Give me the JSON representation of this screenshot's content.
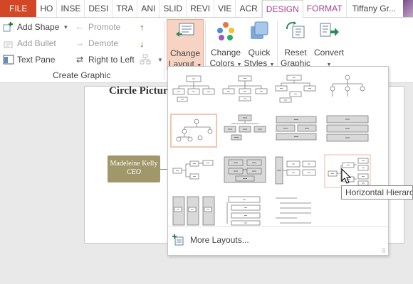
{
  "tabs": [
    "FILE",
    "HO",
    "INSE",
    "DESI",
    "TRA",
    "ANI",
    "SLID",
    "REVI",
    "VIE",
    "ACR",
    "DESIGN",
    "FORMAT"
  ],
  "user": "Tiffany Gr...",
  "ribbon": {
    "create_graphic": {
      "add_shape": "Add Shape",
      "add_bullet": "Add Bullet",
      "text_pane": "Text Pane",
      "promote": "Promote",
      "demote": "Demote",
      "right_to_left": "Right to Left",
      "group_label": "Create Graphic"
    },
    "change_layout": [
      "Change",
      "Layout"
    ],
    "change_colors": [
      "Change",
      "Colors"
    ],
    "quick_styles": [
      "Quick",
      "Styles"
    ],
    "reset_graphic": [
      "Reset",
      "Graphic"
    ],
    "convert": [
      "Convert",
      ""
    ]
  },
  "slide": {
    "title": "Circle Picture",
    "node_name": "Madeleine Kelly",
    "node_role": "CEO"
  },
  "gallery": {
    "more_layouts": "More Layouts...",
    "tooltip": "Horizontal Hierarchy",
    "selected_index": 4,
    "hover_index": 11
  },
  "colors": {
    "file_tab": "#d24726",
    "accent_tab": "#a94090",
    "active_button": "#f7d3c3",
    "node_fill": "#a0986a"
  }
}
